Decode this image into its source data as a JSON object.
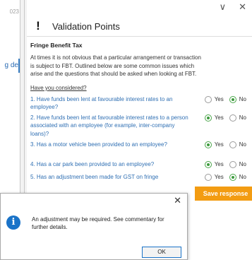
{
  "background": {
    "year_fragment": "023",
    "tab_fragment": "g de"
  },
  "window": {
    "minimize_glyph": "∨",
    "close_glyph": "✕"
  },
  "panel": {
    "icon_glyph": "!",
    "title": "Validation Points",
    "section_title": "Fringe Benefit Tax",
    "intro": "At times it is not obvious that a particular arrangement or transaction is subject to FBT. Outlined below are some common issues which arise and the questions that should be asked when looking at FBT.",
    "have_considered": "Have you considered?",
    "yes_label": "Yes",
    "no_label": "No",
    "questions": [
      {
        "text": "1. Have funds been lent at favourable interest rates to an employee?",
        "answer": "No"
      },
      {
        "text": "2. Have funds been lent at favourable interest rates to a person associated with an employee (for example, inter-company loans)?",
        "answer": "Yes"
      },
      {
        "text": "3. Has a motor vehicle been provided to an employee?",
        "answer": "Yes"
      },
      {
        "text": "4. Has a car park been provided to an employee?",
        "answer": "Yes"
      },
      {
        "text": "5. Has an adjustment been made for GST on fringe",
        "answer": "No"
      }
    ],
    "save_label": "Save response",
    "accent_color": "#f39c12"
  },
  "dialog": {
    "close_glyph": "✕",
    "icon_glyph": "i",
    "message": "An adjustment may be required. See commentary for further details.",
    "ok_label": "OK"
  }
}
